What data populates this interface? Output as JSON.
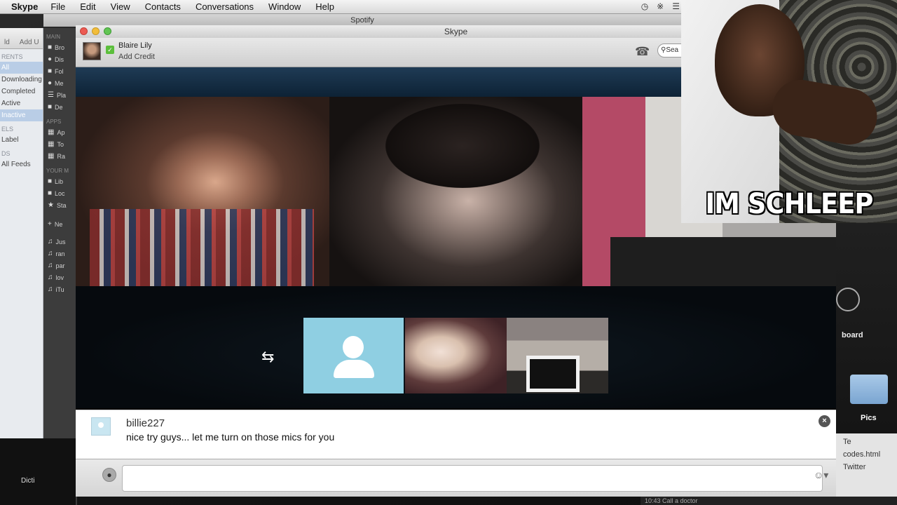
{
  "menubar": {
    "app": "Skype",
    "items": [
      "File",
      "Edit",
      "View",
      "Contacts",
      "Conversations",
      "Window",
      "Help"
    ]
  },
  "background": {
    "spotify_title": "Spotify",
    "left_panel": {
      "toolbar": [
        "ld",
        "Add U"
      ],
      "section_parents": "RENTS",
      "rows": [
        "All",
        "Downloading",
        "Completed",
        "Active",
        "Inactive"
      ],
      "section_labels": "ELS",
      "label_row": "Label",
      "section_feeds": "DS",
      "feeds_row": "All Feeds"
    },
    "itunes_sidebar": {
      "section_main": "MAIN",
      "main_items": [
        "Bro",
        "Dis",
        "Fol",
        "Me",
        "Pla",
        "De"
      ],
      "section_apps": "APPS",
      "app_items": [
        "Ap",
        "To",
        "Ra"
      ],
      "section_your": "YOUR M",
      "your_items": [
        "Lib",
        "Loc",
        "Sta"
      ],
      "new_item": "Ne",
      "playlists": [
        "Jus",
        "ran",
        "par",
        "lov",
        "iTu"
      ]
    },
    "right": {
      "board_label": "board",
      "folder_label": "Pics",
      "links": [
        "Te",
        "codes.html",
        "Twitter"
      ],
      "status": "10:43  Call a doctor"
    },
    "dock_label": "Dicti"
  },
  "skype": {
    "window_title": "Skype",
    "profile": {
      "name": "Blaire Lily",
      "credit": "Add Credit",
      "search": "Sea"
    },
    "chat": {
      "username": "billie227",
      "message": "nice try guys... let me turn on those mics for you"
    }
  },
  "meme": {
    "caption": "IM SCHLEEP"
  }
}
